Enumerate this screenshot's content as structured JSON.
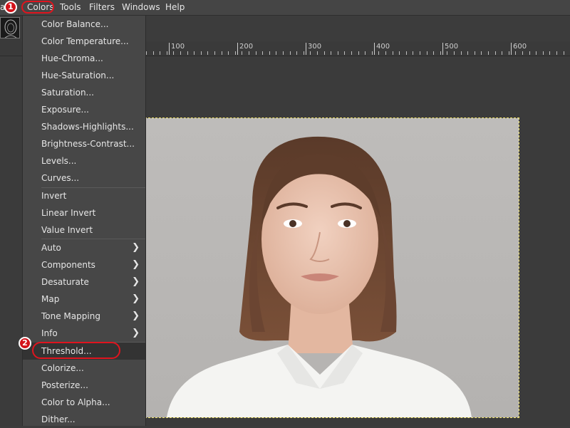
{
  "menubar": {
    "items": [
      "a",
      "Colors",
      "Tools",
      "Filters",
      "Windows",
      "Help"
    ]
  },
  "badges": {
    "step1": "1",
    "step2": "2"
  },
  "ruler": {
    "labels": [
      "100",
      "200",
      "300",
      "400",
      "500",
      "600"
    ]
  },
  "colors_menu": {
    "items": [
      {
        "label": "Color Balance..."
      },
      {
        "label": "Color Temperature..."
      },
      {
        "label": "Hue-Chroma..."
      },
      {
        "label": "Hue-Saturation..."
      },
      {
        "label": "Saturation..."
      },
      {
        "label": "Exposure..."
      },
      {
        "label": "Shadows-Highlights..."
      },
      {
        "label": "Brightness-Contrast..."
      },
      {
        "label": "Levels..."
      },
      {
        "label": "Curves..."
      },
      {
        "label": "Invert"
      },
      {
        "label": "Linear Invert"
      },
      {
        "label": "Value Invert"
      },
      {
        "label": "Auto",
        "submenu": true
      },
      {
        "label": "Components",
        "submenu": true
      },
      {
        "label": "Desaturate",
        "submenu": true
      },
      {
        "label": "Map",
        "submenu": true
      },
      {
        "label": "Tone Mapping",
        "submenu": true
      },
      {
        "label": "Info",
        "submenu": true
      },
      {
        "label": "Threshold...",
        "highlighted": true
      },
      {
        "label": "Colorize..."
      },
      {
        "label": "Posterize..."
      },
      {
        "label": "Color to Alpha..."
      },
      {
        "label": "Dither..."
      }
    ]
  },
  "colors": {
    "accent_red": "#e0141e",
    "selection_dash": "#f2e46b",
    "menu_bg": "#474747",
    "highlight_bg": "#333333"
  }
}
